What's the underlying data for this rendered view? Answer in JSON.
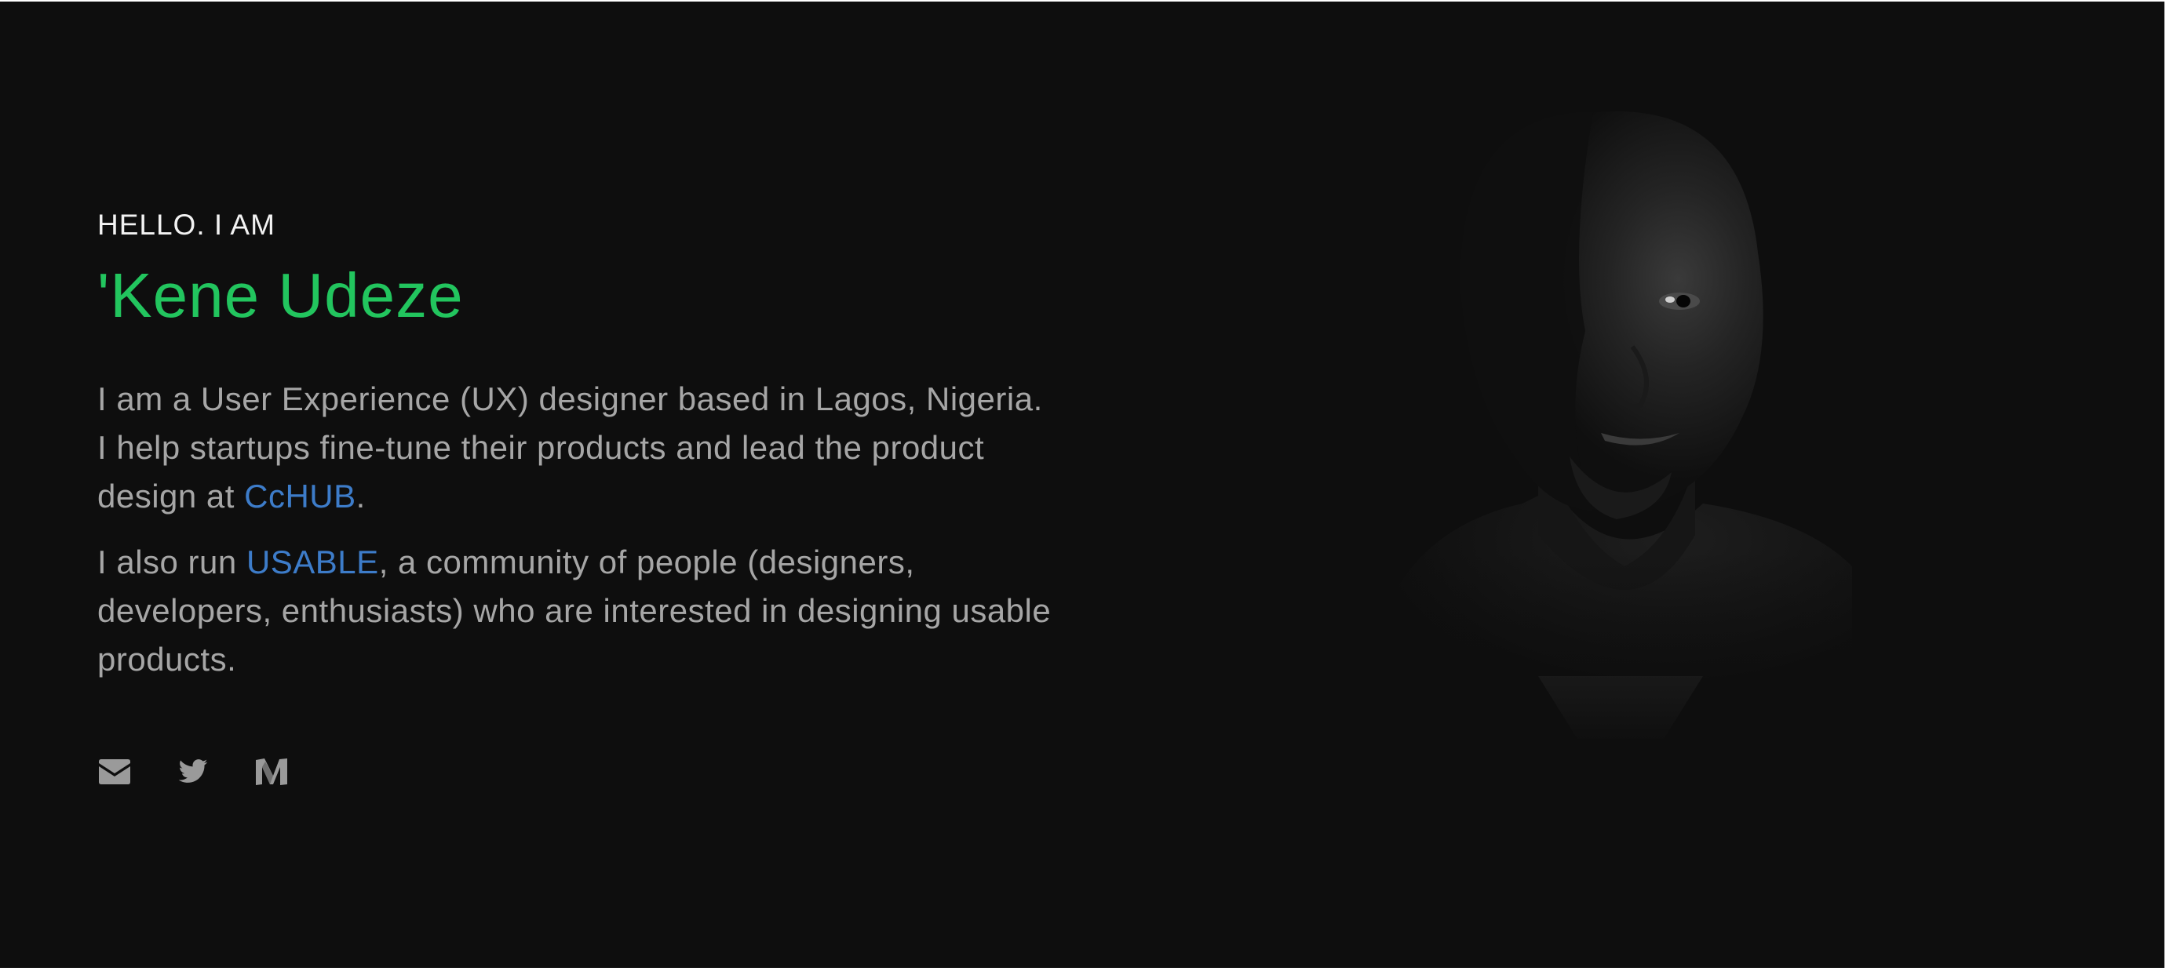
{
  "hero": {
    "greeting": "HELLO. I AM",
    "name": "'Kene Udeze",
    "bio_1": {
      "before": "I am a User Experience (UX) designer based in Lagos, Nigeria. I help startups fine-tune their products and lead the product design at ",
      "link": "CcHUB",
      "after": "."
    },
    "bio_2": {
      "before": "I also run ",
      "link": "USABLE",
      "after": ", a community of people (designers, developers, enthusiasts) who are interested in designing usable products."
    }
  },
  "social": {
    "icons": [
      "mail-icon",
      "twitter-icon",
      "medium-icon"
    ]
  },
  "colors": {
    "background": "#0e0e0e",
    "name_accent": "#22c55e",
    "link": "#3d7cc9",
    "body_text": "#a6a6a6",
    "icon": "#9a9a9a"
  }
}
